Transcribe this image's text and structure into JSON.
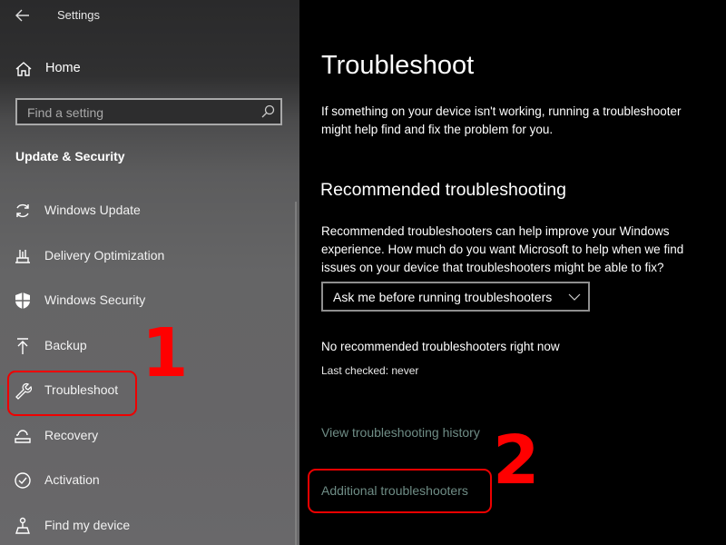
{
  "window": {
    "title": "Settings"
  },
  "sidebar": {
    "home_label": "Home",
    "search": {
      "placeholder": "Find a setting"
    },
    "section_title": "Update & Security",
    "items": [
      {
        "label": "Windows Update",
        "icon": "sync-icon"
      },
      {
        "label": "Delivery Optimization",
        "icon": "delivery-optimization-icon"
      },
      {
        "label": "Windows Security",
        "icon": "shield-icon"
      },
      {
        "label": "Backup",
        "icon": "upload-arrow-icon"
      },
      {
        "label": "Troubleshoot",
        "icon": "wrench-icon",
        "selected": true
      },
      {
        "label": "Recovery",
        "icon": "recovery-icon"
      },
      {
        "label": "Activation",
        "icon": "check-circle-icon"
      },
      {
        "label": "Find my device",
        "icon": "find-device-icon"
      }
    ]
  },
  "main": {
    "title": "Troubleshoot",
    "intro_line1": "If something on your device isn't working, running a troubleshooter",
    "intro_line2": "might help find and fix the problem for you.",
    "recommended_heading": "Recommended troubleshooting",
    "recommended_desc_line1": "Recommended troubleshooters can help improve your Windows",
    "recommended_desc_line2": "experience. How much do you want Microsoft to help when we find",
    "recommended_desc_line3": "issues on your device that troubleshooters might be able to fix?",
    "dropdown_value": "Ask me before running troubleshooters",
    "status": "No recommended troubleshooters right now",
    "last_checked": "Last checked: never",
    "history_link": "View troubleshooting history",
    "additional_link": "Additional troubleshooters"
  },
  "annotations": {
    "step1": "1",
    "step2": "2",
    "color": "#ff0000"
  },
  "colors": {
    "link": "#6f8d86",
    "sidebar_selected": "#3d7a6a"
  }
}
